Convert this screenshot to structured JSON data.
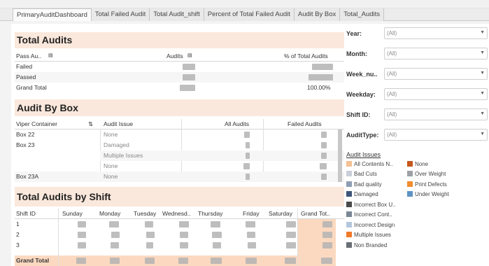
{
  "tabs": [
    {
      "label": "PrimaryAuditDashboard",
      "active": true
    },
    {
      "label": "Total Failed Audit"
    },
    {
      "label": "Total Audit_shift"
    },
    {
      "label": "Percent of Total Failed Audit"
    },
    {
      "label": "Audit By Box"
    },
    {
      "label": "Total_Audits"
    }
  ],
  "total_audits": {
    "title": "Total Audits",
    "headers": {
      "pass": "Pass Au..",
      "audits": "Audits",
      "pct": "% of Total Audits"
    },
    "rows": [
      {
        "label": "Failed",
        "pct": ""
      },
      {
        "label": "Passed",
        "pct": ""
      },
      {
        "label": "Grand Total",
        "pct": "100.00%"
      }
    ]
  },
  "audit_by_box": {
    "title": "Audit By Box",
    "headers": {
      "container": "Viper Container",
      "issue": "Audit Issue",
      "all": "All Audits",
      "failed": "Failed Audits"
    },
    "rows": [
      {
        "container": "Box 22",
        "issue": "None"
      },
      {
        "container": "Box 23",
        "issue": "Damaged"
      },
      {
        "container": "",
        "issue": "Multiple Issues"
      },
      {
        "container": "",
        "issue": "None"
      },
      {
        "container": "Box 23A",
        "issue": "None"
      }
    ]
  },
  "shift": {
    "title": "Total Audits by Shift",
    "headers": [
      "Shift ID",
      "Sunday",
      "Monday",
      "Tuesday",
      "Wednesd..",
      "Thursday",
      "Friday",
      "Saturday",
      "Grand Tot.."
    ],
    "rows": [
      "1",
      "2",
      "3",
      "Grand Total"
    ]
  },
  "filters": [
    {
      "label": "Year:",
      "value": "(All)"
    },
    {
      "label": "Month:",
      "value": "(All)"
    },
    {
      "label": "Week_nu..",
      "value": "(All)"
    },
    {
      "label": "Weekday:",
      "value": "(All)"
    },
    {
      "label": "Shift ID:",
      "value": "(All)"
    },
    {
      "label": "AuditType:",
      "value": "(All)"
    }
  ],
  "legend": {
    "title": "Audit Issues",
    "col1": [
      {
        "label": "All Contents N..",
        "color": "#f5c093"
      },
      {
        "label": "Bad Cuts",
        "color": "#c9cfd9"
      },
      {
        "label": "Bad quality",
        "color": "#8e9eb3"
      },
      {
        "label": "Damaged",
        "color": "#3e5578"
      },
      {
        "label": "Incorrect Box U..",
        "color": "#4a4a4a"
      },
      {
        "label": "Incorrect Cont..",
        "color": "#7a8796"
      },
      {
        "label": "Incorrect Design",
        "color": "#b5c7dd"
      },
      {
        "label": "Multiple Issues",
        "color": "#f07a2a"
      },
      {
        "label": "Non Branded",
        "color": "#6a6f76"
      }
    ],
    "col2": [
      {
        "label": "None",
        "color": "#c4571c"
      },
      {
        "label": "Over Weight",
        "color": "#9da1a6"
      },
      {
        "label": "Print Defects",
        "color": "#f28c2e"
      },
      {
        "label": "Under Weight",
        "color": "#5e93c4"
      }
    ]
  }
}
